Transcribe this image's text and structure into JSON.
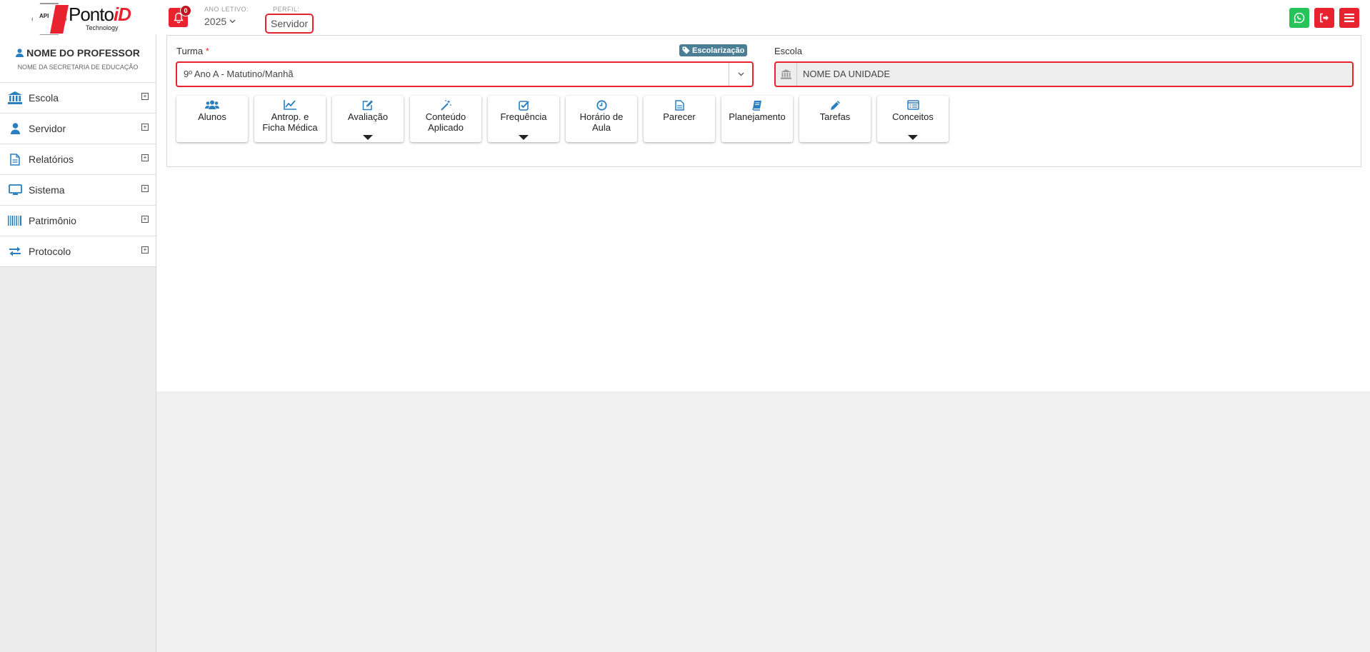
{
  "header": {
    "logo": {
      "hex_text": "API",
      "brand_main": "Ponto",
      "brand_accent": "iD",
      "brand_sub": "Technology"
    },
    "notifications_count": "0",
    "ano_letivo_label": "ANO LETIVO:",
    "ano_letivo_value": "2025",
    "perfil_label": "PERFIL:",
    "perfil_value": "Servidor",
    "accent_color": "#e8222e",
    "whatsapp_color": "#25c35a"
  },
  "sidebar": {
    "user_name": "NOME DO PROFESSOR",
    "user_org": "NOME DA SECRETARIA DE EDUCAÇÃO",
    "items": [
      {
        "label": "Escola",
        "icon": "bank-icon"
      },
      {
        "label": "Servidor",
        "icon": "user-icon"
      },
      {
        "label": "Relatórios",
        "icon": "file-icon"
      },
      {
        "label": "Sistema",
        "icon": "monitor-icon"
      },
      {
        "label": "Patrimônio",
        "icon": "barcode-icon"
      },
      {
        "label": "Protocolo",
        "icon": "exchange-icon"
      }
    ]
  },
  "form": {
    "turma_label": "Turma",
    "turma_required": "*",
    "badge_label": "Escolarização",
    "turma_value": "9º Ano A - Matutino/Manhã",
    "escola_label": "Escola",
    "escola_value": "NOME DA UNIDADE"
  },
  "tiles": [
    {
      "line1": "Alunos",
      "line2": "",
      "icon": "users-icon",
      "dropdown": false
    },
    {
      "line1": "Antrop. e",
      "line2": "Ficha Médica",
      "icon": "line-chart-icon",
      "dropdown": false
    },
    {
      "line1": "Avaliação",
      "line2": "",
      "icon": "edit-icon",
      "dropdown": true
    },
    {
      "line1": "Conteúdo",
      "line2": "Aplicado",
      "icon": "magic-wand-icon",
      "dropdown": false
    },
    {
      "line1": "Frequência",
      "line2": "",
      "icon": "check-square-icon",
      "dropdown": true
    },
    {
      "line1": "Horário de",
      "line2": "Aula",
      "icon": "clock-icon",
      "dropdown": false
    },
    {
      "line1": "Parecer",
      "line2": "",
      "icon": "document-icon",
      "dropdown": false
    },
    {
      "line1": "Planejamento",
      "line2": "",
      "icon": "book-icon",
      "dropdown": false
    },
    {
      "line1": "Tarefas",
      "line2": "",
      "icon": "pencil-icon",
      "dropdown": false
    },
    {
      "line1": "Conceitos",
      "line2": "",
      "icon": "list-alt-icon",
      "dropdown": true
    }
  ]
}
